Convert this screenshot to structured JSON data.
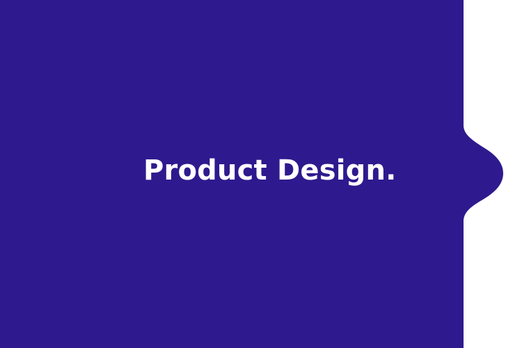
{
  "hero": {
    "title": "Product Design."
  },
  "colors": {
    "panel": "#2E1A8E",
    "background": "#FFFFFF",
    "text": "#FFFFFF"
  }
}
